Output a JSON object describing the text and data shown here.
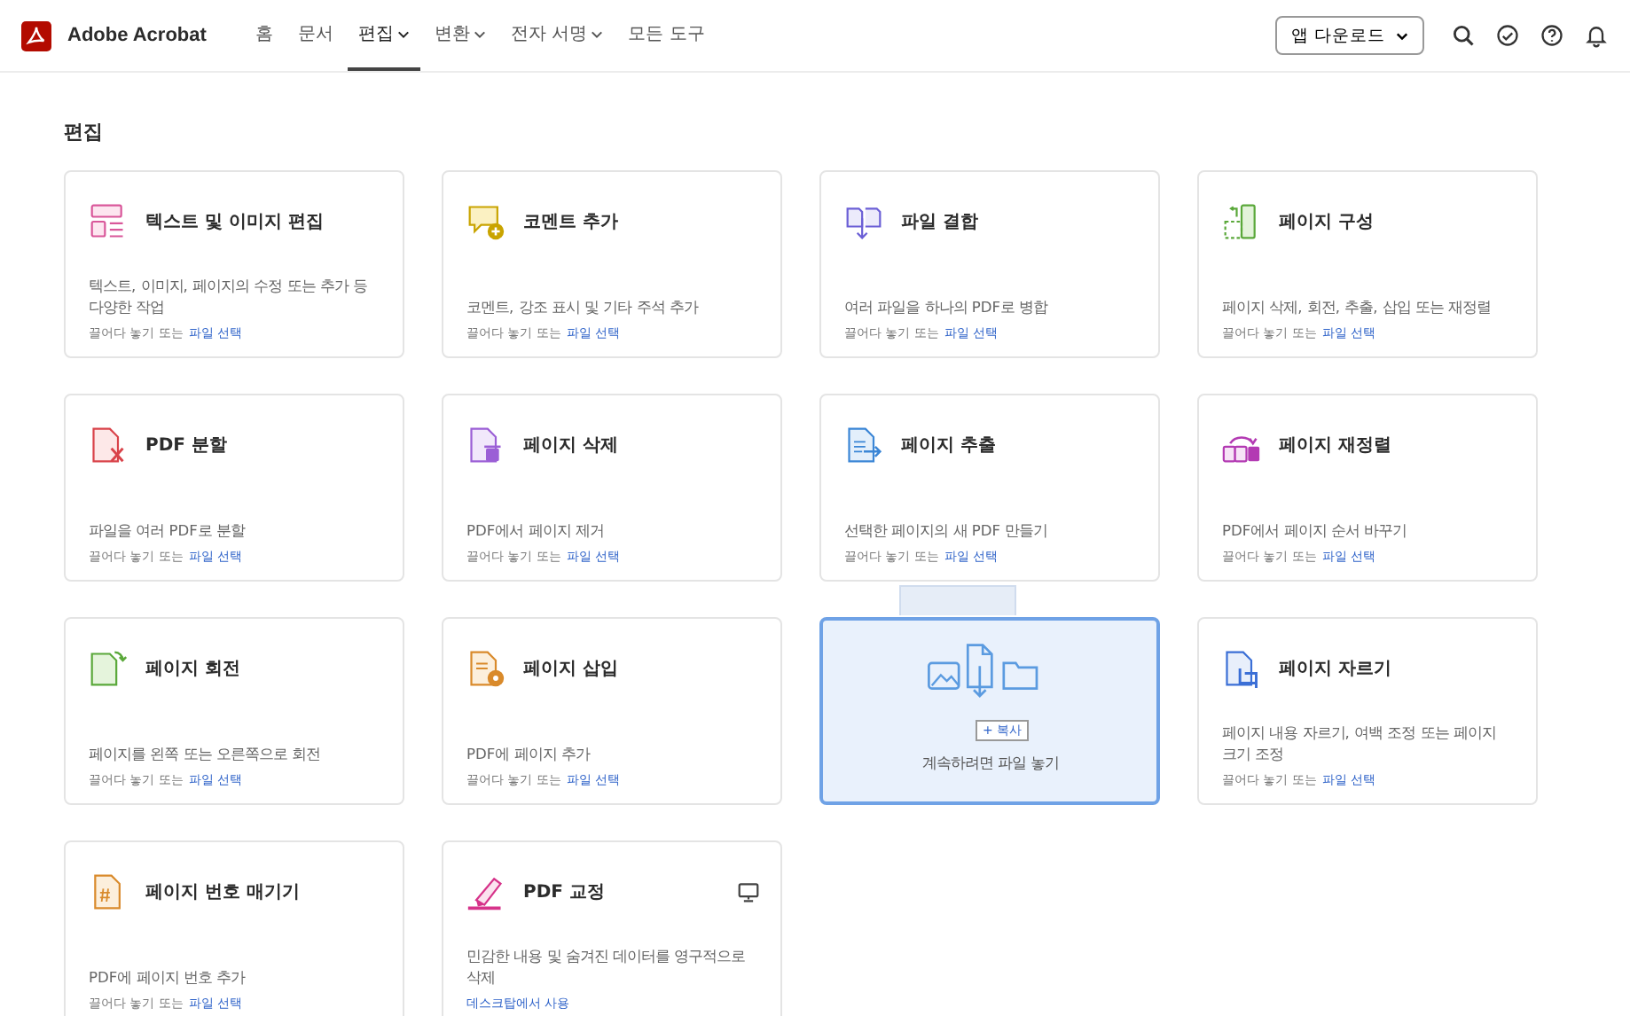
{
  "header": {
    "app_name": "Adobe Acrobat",
    "nav": [
      {
        "label": "홈",
        "dropdown": false,
        "selected": false
      },
      {
        "label": "문서",
        "dropdown": false,
        "selected": false
      },
      {
        "label": "편집",
        "dropdown": true,
        "selected": true
      },
      {
        "label": "변환",
        "dropdown": true,
        "selected": false
      },
      {
        "label": "전자 서명",
        "dropdown": true,
        "selected": false
      },
      {
        "label": "모든 도구",
        "dropdown": false,
        "selected": false
      }
    ],
    "download_button": "앱 다운로드"
  },
  "section_title": "편집",
  "cards": [
    {
      "kind": "tool",
      "title": "텍스트 및 이미지 편집",
      "description": "텍스트, 이미지, 페이지의 수정 또는 추가 등 다양한 작업",
      "hint": "끌어다 놓기 또는",
      "link": "파일 선택"
    },
    {
      "kind": "tool",
      "title": "코멘트 추가",
      "description": "코멘트, 강조 표시 및 기타 주석 추가",
      "hint": "끌어다 놓기 또는",
      "link": "파일 선택"
    },
    {
      "kind": "tool",
      "title": "파일 결합",
      "description": "여러 파일을 하나의 PDF로 병합",
      "hint": "끌어다 놓기 또는",
      "link": "파일 선택"
    },
    {
      "kind": "tool",
      "title": "페이지 구성",
      "description": "페이지 삭제, 회전, 추출, 삽입 또는 재정렬",
      "hint": "끌어다 놓기 또는",
      "link": "파일 선택"
    },
    {
      "kind": "tool",
      "title": "PDF 분할",
      "description": "파일을 여러 PDF로 분할",
      "hint": "끌어다 놓기 또는",
      "link": "파일 선택"
    },
    {
      "kind": "tool",
      "title": "페이지 삭제",
      "description": "PDF에서 페이지 제거",
      "hint": "끌어다 놓기 또는",
      "link": "파일 선택"
    },
    {
      "kind": "tool",
      "title": "페이지 추출",
      "description": "선택한 페이지의 새 PDF 만들기",
      "hint": "끌어다 놓기 또는",
      "link": "파일 선택"
    },
    {
      "kind": "tool",
      "title": "페이지 재정렬",
      "description": "PDF에서 페이지 순서 바꾸기",
      "hint": "끌어다 놓기 또는",
      "link": "파일 선택"
    },
    {
      "kind": "tool",
      "title": "페이지 회전",
      "description": "페이지를 왼쪽 또는 오른쪽으로 회전",
      "hint": "끌어다 놓기 또는",
      "link": "파일 선택"
    },
    {
      "kind": "tool",
      "title": "페이지 삽입",
      "description": "PDF에 페이지 추가",
      "hint": "끌어다 놓기 또는",
      "link": "파일 선택"
    },
    {
      "kind": "drop",
      "badge": "+ 복사",
      "message": "계속하려면 파일 놓기"
    },
    {
      "kind": "tool",
      "title": "페이지 자르기",
      "description": "페이지 내용 자르기, 여백 조정 또는 페이지 크기 조정",
      "hint": "끌어다 놓기 또는",
      "link": "파일 선택"
    },
    {
      "kind": "tool",
      "title": "페이지 번호 매기기",
      "description": "PDF에 페이지 번호 추가",
      "hint": "끌어다 놓기 또는",
      "link": "파일 선택"
    },
    {
      "kind": "desktop",
      "title": "PDF 교정",
      "description": "민감한 내용 및 숨겨진 데이터를 영구적으로 삭제",
      "link": "데스크탑에서 사용"
    }
  ]
}
